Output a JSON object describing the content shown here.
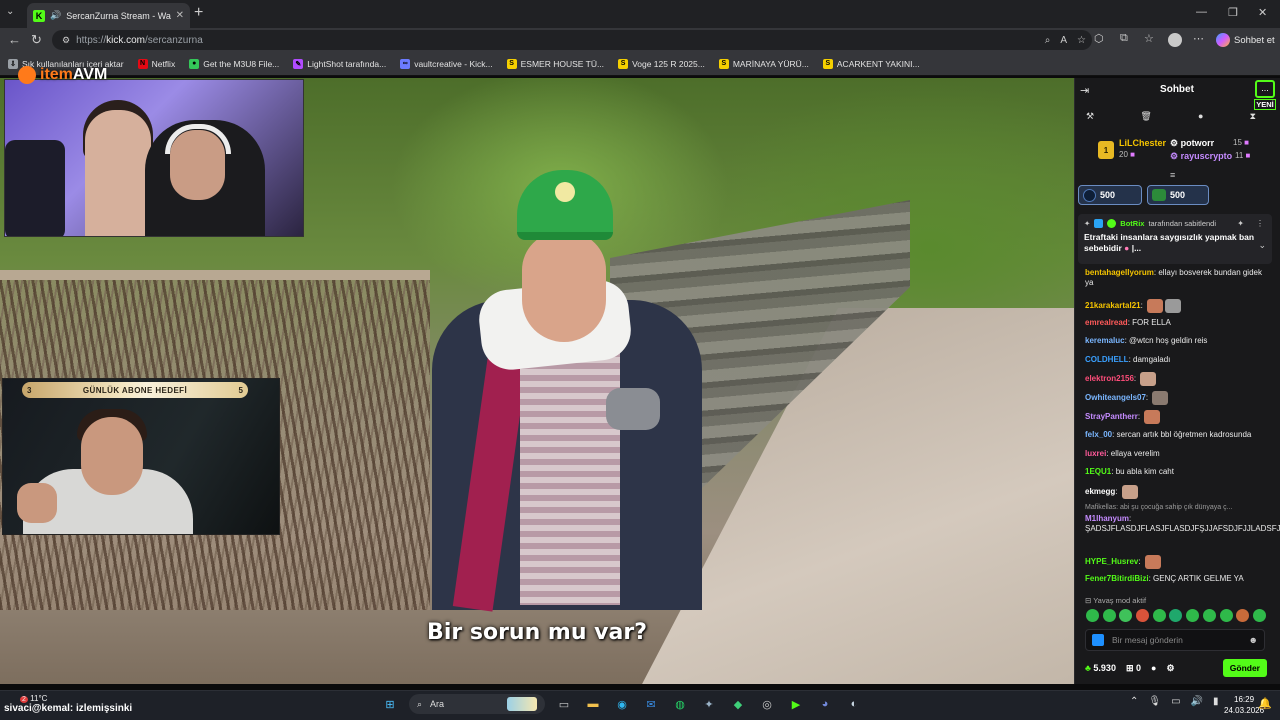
{
  "browser": {
    "tab_title": "SercanZurna Stream - Watch",
    "url_host": "kick.com",
    "url_scheme": "https://",
    "url_path": "/sercanzurna",
    "copilot_label": "Sohbet et",
    "new_tab": "+",
    "bookmarks": [
      {
        "label": "Sık kullanılanları içeri aktar",
        "icon": "import-icon",
        "color": "#9aa0a6",
        "glyph": "⇩"
      },
      {
        "label": "Netflix",
        "icon": "netflix-icon",
        "color": "#e50914",
        "glyph": "N"
      },
      {
        "label": "Get the M3U8 File...",
        "icon": "m3u8-icon",
        "color": "#34c759",
        "glyph": "●"
      },
      {
        "label": "LightShot tarafında...",
        "icon": "lightshot-icon",
        "color": "#b14cff",
        "glyph": "✎"
      },
      {
        "label": "vaultcreative - Kick...",
        "icon": "vault-icon",
        "color": "#6c7bff",
        "glyph": "∞"
      },
      {
        "label": "ESMER HOUSE TÜ...",
        "icon": "s-icon",
        "color": "#f5d000",
        "glyph": "S"
      },
      {
        "label": "Voge 125 R 2025...",
        "icon": "s-icon",
        "color": "#f5d000",
        "glyph": "S"
      },
      {
        "label": "MARİNAYA YÜRÜ...",
        "icon": "s-icon",
        "color": "#f5d000",
        "glyph": "S"
      },
      {
        "label": "ACARKENT YAKINI...",
        "icon": "s-icon",
        "color": "#f5d000",
        "glyph": "S"
      }
    ]
  },
  "video": {
    "subtitle": "Bir sorun mu var?",
    "overlay_brand_prefix": "item",
    "overlay_brand_suffix": "AVM",
    "goal_label": "GÜNLÜK ABONE HEDEFİ",
    "goal_current": "3",
    "goal_target": "5"
  },
  "chat": {
    "title": "Sohbet",
    "more_label": "...",
    "new_badge": "YENİ",
    "leaderboard": {
      "first_rank": "1",
      "first_name": "LiLChester",
      "first_count": "20",
      "second_name": "potworr",
      "second_count": "15",
      "third_name": "rayuscrypto",
      "third_count": "11"
    },
    "gifts": [
      {
        "amount": "500"
      },
      {
        "amount": "500"
      }
    ],
    "pinned": {
      "bot": "BotRix",
      "pinned_by": "tarafından sabitlendi",
      "message": "Etraftaki insanlara saygısızlık yapmak ban sebebidir",
      "tail": "|..."
    },
    "messages": [
      {
        "user": "bentahagellyorum",
        "color": "#f5c400",
        "text": "ellayı bosverek bundan gidek ya",
        "emotes": 0
      },
      {
        "user": "21karakartal21",
        "color": "#f5c400",
        "text": "",
        "emotes": 2
      },
      {
        "user": "emrealread",
        "color": "#ff5a5a",
        "text": "FOR ELLA",
        "emotes": 0
      },
      {
        "user": "keremaluc",
        "color": "#7ab6ff",
        "text": "@wtcn hoş geldin reis",
        "emotes": 0
      },
      {
        "user": "COLDHELL",
        "color": "#3aa0ff",
        "text": "damgaladı",
        "emotes": 0
      },
      {
        "user": "elektron2156",
        "color": "#ff4d7a",
        "text": "",
        "emotes": 1
      },
      {
        "user": "Owhiteangels07",
        "color": "#7ab6ff",
        "text": "",
        "emotes": 1
      },
      {
        "user": "StrayPantherr",
        "color": "#c58bff",
        "text": "",
        "emotes": 1
      },
      {
        "user": "felx_00",
        "color": "#7ab6ff",
        "text": "sercan artık bbl öğretmen kadrosunda",
        "emotes": 0
      },
      {
        "user": "luxrei",
        "color": "#ff5a9a",
        "text": "ellaya verelim",
        "emotes": 0
      },
      {
        "user": "1EQU1",
        "color": "#53fc18",
        "text": "bu abla kim caht",
        "emotes": 0
      },
      {
        "user": "ekmegg",
        "color": "#ffffff",
        "text": "",
        "emotes": 1
      },
      {
        "user": "M1lhanyum",
        "color": "#c58bff",
        "text": "ŞADSJFLASDJFLASJFLASDJFŞJJAFSDJFJJLADSFJASDJLf",
        "emotes": 0
      },
      {
        "user": "HYPE_Husrev",
        "color": "#53fc18",
        "text": "",
        "emotes": 1
      },
      {
        "user": "Fener7BitirdiBizi",
        "color": "#53fc18",
        "text": "GENÇ ARTIK GELME YA",
        "emotes": 0
      }
    ],
    "reply_hint": "Mafikellas: abi şu çocuğa sahip çık dünyaya ç...",
    "slow_mode": "Yavaş mod aktif",
    "input_placeholder": "Bir mesaj gönderin",
    "points": "5.930",
    "gift_count": "0",
    "send_label": "Gönder"
  },
  "taskbar": {
    "temperature": "11°C",
    "weather_badge": "2",
    "search_label": "Ara",
    "time": "16:29",
    "date": "24.03.2026",
    "watching_user": "sivaci@kemal",
    "watching_text": ": izlemişsinki"
  }
}
